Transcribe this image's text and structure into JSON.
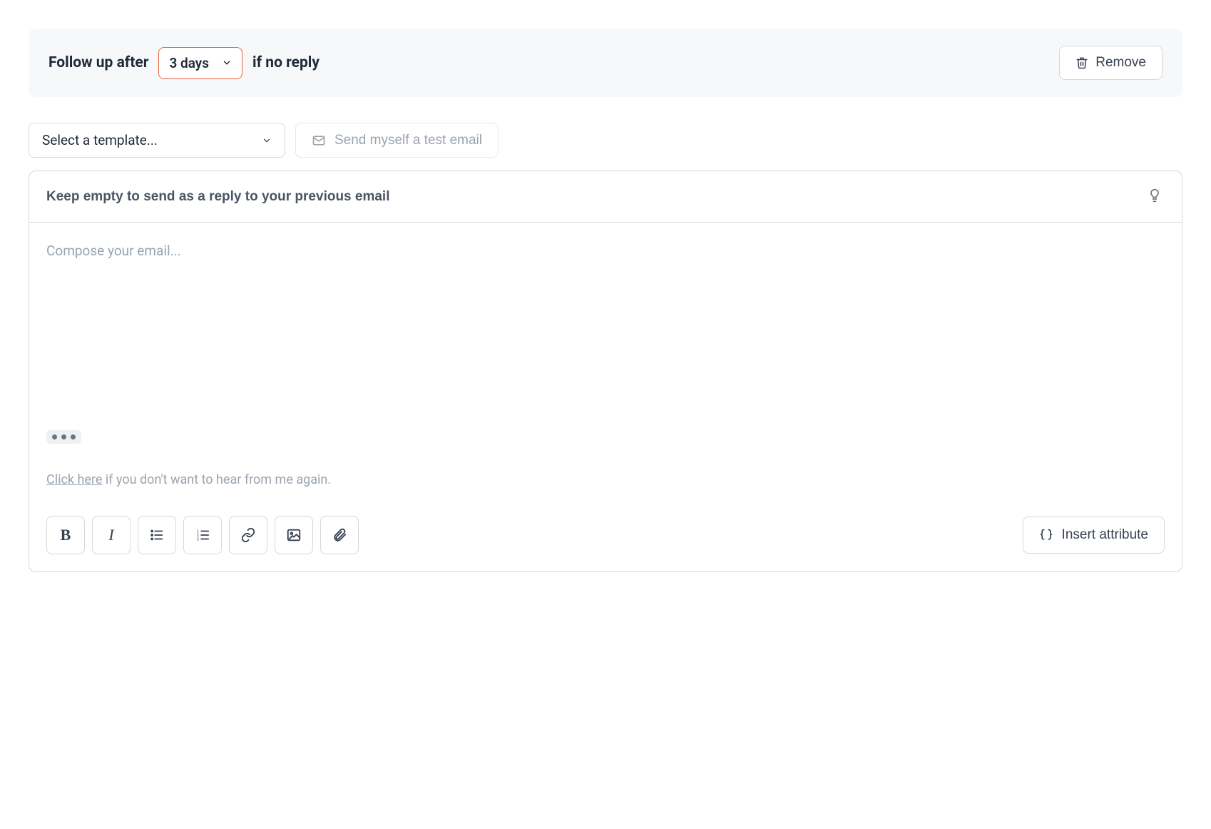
{
  "followup": {
    "prefix": "Follow up after",
    "days_value": "3 days",
    "suffix": "if no reply",
    "remove_label": "Remove"
  },
  "controls": {
    "template_placeholder": "Select a template...",
    "test_email_label": "Send myself a test email"
  },
  "editor": {
    "subject_placeholder": "Keep empty to send as a reply to your previous email",
    "body_placeholder": "Compose your email...",
    "unsubscribe_link": "Click here",
    "unsubscribe_rest": " if you don't want to hear from me again."
  },
  "toolbar": {
    "insert_attribute_label": "Insert attribute"
  }
}
